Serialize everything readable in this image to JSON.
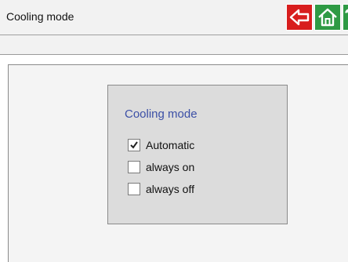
{
  "header": {
    "title": "Cooling mode",
    "buttons": [
      {
        "name": "back",
        "icon": "back-arrow-icon",
        "color": "#d81e1e"
      },
      {
        "name": "home",
        "icon": "home-icon",
        "color": "#2e9a44"
      },
      {
        "name": "help",
        "label": "?",
        "color": "#2e9a44"
      }
    ]
  },
  "panel": {
    "title": "Cooling mode",
    "options": [
      {
        "label": "Automatic",
        "checked": true
      },
      {
        "label": "always on",
        "checked": false
      },
      {
        "label": "always off",
        "checked": false
      }
    ]
  }
}
